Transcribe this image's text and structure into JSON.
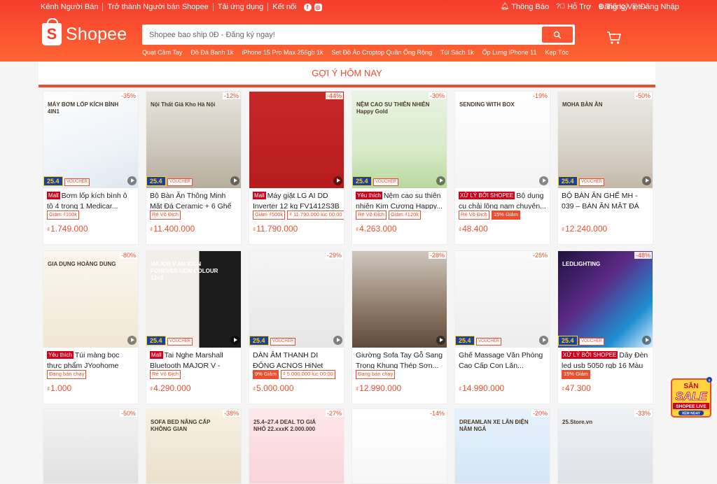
{
  "topbar": {
    "seller_center": "Kênh Người Bán",
    "become_seller": "Trở thành Người bán Shopee",
    "download": "Tải ứng dụng",
    "connect": "Kết nối",
    "notifications": "Thông Báo",
    "help": "Hỗ Trợ",
    "language": "Tiếng Việt",
    "register": "Đăng Ký",
    "login": "Đăng Nhập"
  },
  "header": {
    "logo_text": "Shopee",
    "search_placeholder": "Shopee bao ship 0Đ - Đăng ký ngay!",
    "suggestions": [
      "Quạt Cầm Tay",
      "Đồ Đá Banh 1k",
      "iPhone 15 Pro Max 256gb 1k",
      "Set Đồ Áo Croptop Quần Ống Rộng",
      "Túi Sách 1k",
      "Ốp Lưng iPhone 11",
      "Kẹp Tóc"
    ]
  },
  "section_title": "GỢI Ý HÔM NAY",
  "products": [
    {
      "title": "Bơm lốp kích bình ô tô 4 trong 1 Medicar...",
      "badge": "Mall",
      "discount": "-35%",
      "price": "1.749.000",
      "chips": [
        "Giảm ₫100k"
      ],
      "img_text": "MÁY BƠM LỐP KÍCH BÌNH 4IN1"
    },
    {
      "title": "Bộ Bàn Ăn Thông Minh Mặt Đá Ceramic + 6 Ghế đến...",
      "badge": "",
      "discount": "-12%",
      "price": "11.400.000",
      "chips": [
        "Rẻ Vô Địch"
      ],
      "img_text": "Nội Thất Giá Kho Hà Nội"
    },
    {
      "title": "Máy giặt LG AI DD Inverter 12 kg FV1412S3B",
      "badge": "Mall",
      "discount": "-44%",
      "price": "11.790.000",
      "chips": [
        "Giảm ₫500k",
        "₫ 11.790.000 lúc 00:00"
      ],
      "img_text": ""
    },
    {
      "title": "Nệm cao su thiên nhiên Kim Cương Happy...",
      "badge": "Yêu thích",
      "discount": "-30%",
      "price": "4.263.000",
      "chips": [
        "Rẻ Vô Địch",
        "Giảm ₫120k"
      ],
      "img_text": "NỆM CAO SU THIÊN NHIÊN Happy Gold"
    },
    {
      "title": "Bộ dụng cụ chải lông nam chuyên...",
      "badge": "XỬ LÝ BỞI SHOPEE",
      "discount": "-19%",
      "price": "48.400",
      "chips": [
        "Rẻ Vô Địch",
        "15% Giảm"
      ],
      "img_text": "SENDING WITH BOX"
    },
    {
      "title": "BỘ BÀN ĂN GHẾ MH - 039 – BÀN ĂN MẶT ĐÁ VI...",
      "badge": "",
      "discount": "-50%",
      "price": "12.240.000",
      "chips": [],
      "img_text": "MOHA BÀN ĂN"
    },
    {
      "title": "Túi màng bọc thực phẩm JYoohome ch...",
      "badge": "Yêu thích",
      "discount": "-80%",
      "price": "1.000",
      "chips": [
        "Đang bán chạy"
      ],
      "img_text": "GIA DỤNG HOÀNG DUNG"
    },
    {
      "title": "Tai Nghe Marshall Bluetooth MAJOR V - Pin...",
      "badge": "Mall",
      "discount": "",
      "price": "4.290.000",
      "chips": [
        "Rẻ Vô Địch"
      ],
      "img_text": "MAJOR V AN ICON FOREVER NEW COLOUR 12+3"
    },
    {
      "title": "DÀN ÂM THANH DI ĐỘNG ACNOS HiNet 3600 - MẢ...",
      "badge": "",
      "discount": "-29%",
      "price": "5.000.000",
      "chips": [
        "9% Giảm",
        "₫ 5.000.000 lúc 00:00"
      ],
      "img_text": ""
    },
    {
      "title": "Giường Sofa Tay Gỗ Sang Trọng Khung Thép Sơn...",
      "badge": "",
      "discount": "-28%",
      "price": "12.990.000",
      "chips": [
        "Đang bán chạy"
      ],
      "img_text": ""
    },
    {
      "title": "Ghế Massage Văn Phòng Cao Cấp Con Lăn...",
      "badge": "",
      "discount": "-25%",
      "price": "14.990.000",
      "chips": [],
      "img_text": ""
    },
    {
      "title": "Dây Đèn led usb 5050 rgb 16 Màu Th...",
      "badge": "XỬ LÝ BỞI SHOPEE",
      "discount": "-48%",
      "price": "47.300",
      "chips": [
        "15% Giảm"
      ],
      "img_text": "LEDLIGHTING"
    },
    {
      "title": "",
      "badge": "",
      "discount": "-50%",
      "price": "",
      "chips": [],
      "img_text": ""
    },
    {
      "title": "",
      "badge": "",
      "discount": "-38%",
      "price": "",
      "chips": [],
      "img_text": "SOFA BED NÂNG CẤP KHÔNG GIAN"
    },
    {
      "title": "",
      "badge": "",
      "discount": "-27%",
      "price": "",
      "chips": [],
      "img_text": "25.4–27.4 DEAL TO GIÁ NHỎ 22.xxxK 2.000.000"
    },
    {
      "title": "",
      "badge": "",
      "discount": "-14%",
      "price": "",
      "chips": [],
      "img_text": ""
    },
    {
      "title": "",
      "badge": "",
      "discount": "-20%",
      "price": "",
      "chips": [],
      "img_text": "DREAMLAN XE LĂN ĐIỆN NẰM NGẢ"
    },
    {
      "title": "",
      "badge": "",
      "discount": "-33%",
      "price": "",
      "chips": [],
      "img_text": "25.Store.vn"
    }
  ],
  "float_banner": {
    "line1": "SĂN",
    "line2": "SALE",
    "line3": "SHOPEE LIVE",
    "cta": "XEM NGAY"
  },
  "colors": {
    "brand": "#ee4d2d",
    "header_top": "#f53d2d",
    "header_bottom": "#ff6633",
    "event_blue": "#1a3fa8",
    "event_yellow": "#ffd400"
  }
}
